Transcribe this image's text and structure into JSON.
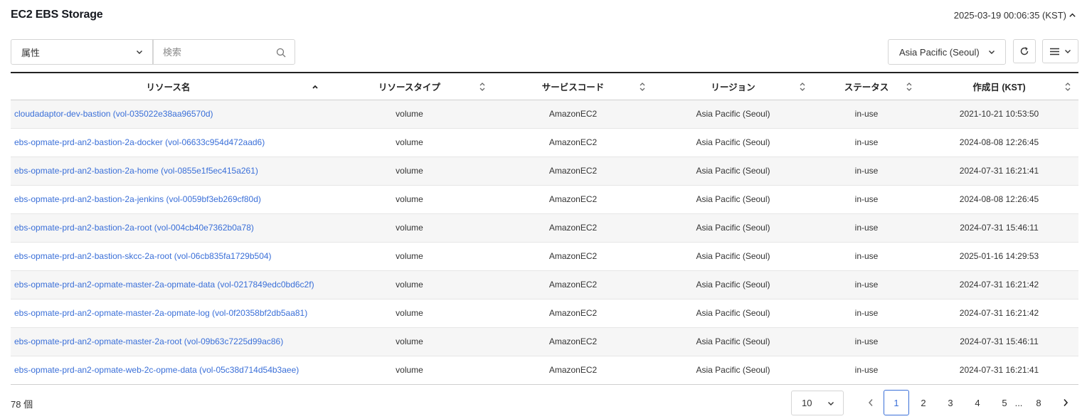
{
  "header": {
    "title": "EC2 EBS Storage",
    "timestamp": "2025-03-19 00:06:35 (KST)"
  },
  "toolbar": {
    "attribute_select": "属性",
    "search_placeholder": "検索",
    "region_select": "Asia Pacific (Seoul)"
  },
  "table": {
    "columns": [
      "リソース名",
      "リソースタイプ",
      "サービスコード",
      "リージョン",
      "ステータス",
      "作成日 (KST)"
    ],
    "rows": [
      [
        "cloudadaptor-dev-bastion (vol-035022e38aa96570d)",
        "volume",
        "AmazonEC2",
        "Asia Pacific (Seoul)",
        "in-use",
        "2021-10-21 10:53:50"
      ],
      [
        "ebs-opmate-prd-an2-bastion-2a-docker (vol-06633c954d472aad6)",
        "volume",
        "AmazonEC2",
        "Asia Pacific (Seoul)",
        "in-use",
        "2024-08-08 12:26:45"
      ],
      [
        "ebs-opmate-prd-an2-bastion-2a-home (vol-0855e1f5ec415a261)",
        "volume",
        "AmazonEC2",
        "Asia Pacific (Seoul)",
        "in-use",
        "2024-07-31 16:21:41"
      ],
      [
        "ebs-opmate-prd-an2-bastion-2a-jenkins (vol-0059bf3eb269cf80d)",
        "volume",
        "AmazonEC2",
        "Asia Pacific (Seoul)",
        "in-use",
        "2024-08-08 12:26:45"
      ],
      [
        "ebs-opmate-prd-an2-bastion-2a-root (vol-004cb40e7362b0a78)",
        "volume",
        "AmazonEC2",
        "Asia Pacific (Seoul)",
        "in-use",
        "2024-07-31 15:46:11"
      ],
      [
        "ebs-opmate-prd-an2-bastion-skcc-2a-root (vol-06cb835fa1729b504)",
        "volume",
        "AmazonEC2",
        "Asia Pacific (Seoul)",
        "in-use",
        "2025-01-16 14:29:53"
      ],
      [
        "ebs-opmate-prd-an2-opmate-master-2a-opmate-data (vol-0217849edc0bd6c2f)",
        "volume",
        "AmazonEC2",
        "Asia Pacific (Seoul)",
        "in-use",
        "2024-07-31 16:21:42"
      ],
      [
        "ebs-opmate-prd-an2-opmate-master-2a-opmate-log (vol-0f20358bf2db5aa81)",
        "volume",
        "AmazonEC2",
        "Asia Pacific (Seoul)",
        "in-use",
        "2024-07-31 16:21:42"
      ],
      [
        "ebs-opmate-prd-an2-opmate-master-2a-root (vol-09b63c7225d99ac86)",
        "volume",
        "AmazonEC2",
        "Asia Pacific (Seoul)",
        "in-use",
        "2024-07-31 15:46:11"
      ],
      [
        "ebs-opmate-prd-an2-opmate-web-2c-opme-data (vol-05c38d714d54b3aee)",
        "volume",
        "AmazonEC2",
        "Asia Pacific (Seoul)",
        "in-use",
        "2024-07-31 16:21:41"
      ]
    ]
  },
  "footer": {
    "total": "78 個",
    "page_size": "10",
    "pages": [
      "1",
      "2",
      "3",
      "4",
      "5",
      "...",
      "8"
    ],
    "current_page": "1"
  },
  "colors": {
    "link": "#3a6fd8",
    "border": "#d5d5d5",
    "row_alt": "#f6f6f6"
  },
  "icons": {
    "timestamp_toggle": "chevron-up-icon",
    "select_arrow": "chevron-down-icon",
    "search": "search-icon",
    "refresh": "refresh-icon",
    "menu": "hamburger-icon",
    "sort_asc": "sort-ascending-icon",
    "sort_both": "sort-icon",
    "prev": "chevron-left-icon",
    "next": "chevron-right-icon"
  }
}
